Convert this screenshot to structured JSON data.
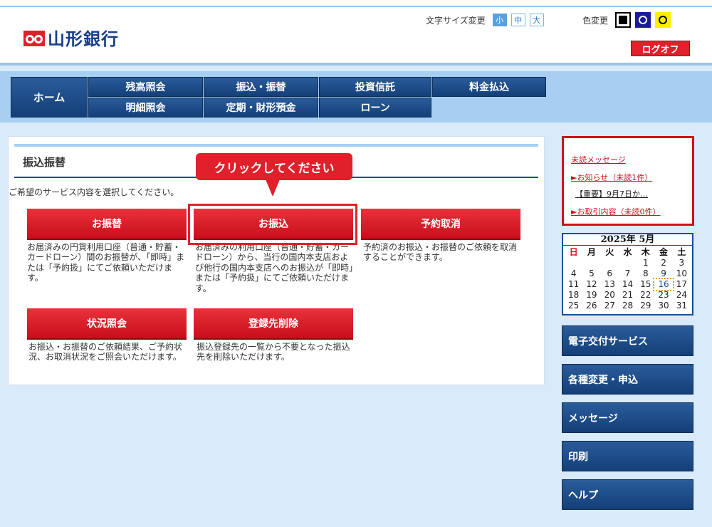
{
  "header": {
    "bank_name": "山形銀行",
    "font_size_label": "文字サイズ変更",
    "font_sizes": [
      "小",
      "中",
      "大"
    ],
    "color_label": "色変更",
    "logout_label": "ログオフ"
  },
  "nav": {
    "home": "ホーム",
    "row1": [
      "残高照会",
      "振込・振替",
      "投資信託",
      "料金払込"
    ],
    "row2": [
      "明細照会",
      "定期・財形預金",
      "ローン"
    ]
  },
  "main": {
    "title": "振込振替",
    "instruction": "ご希望のサービス内容を選択してください。",
    "callout": "クリックしてください",
    "services": [
      {
        "label": "お振替",
        "desc": "お届済みの円貨利用口座（普通・貯蓄・カードローン）間のお振替が、「即時」または「予約扱」にてご依頼いただけます。"
      },
      {
        "label": "お振込",
        "desc": "お届済みの利用口座（普通・貯蓄・カードローン）から、当行の国内本支店および他行の国内本支店へのお振込が「即時」または「予約扱」にてご依頼いただけます。"
      },
      {
        "label": "予約取消",
        "desc": "予約済のお振込・お振替のご依頼を取消することができます。"
      },
      {
        "label": "状況照会",
        "desc": "お振込・お振替のご依頼結果、ご予約状況、お取消状況をご照会いただけます。"
      },
      {
        "label": "登録先削除",
        "desc": "振込登録先の一覧から不要となった振込先を削除いただけます。"
      }
    ]
  },
  "sidebar": {
    "unread_messages": "未読メッセージ",
    "notice_label": "►お知らせ（未読1件）",
    "notice_item": "【重要】9月7日か…",
    "transaction_label": "►お取引内容（未読0件）",
    "calendar": {
      "title": "2025年 5月",
      "weekdays": [
        "日",
        "月",
        "火",
        "水",
        "木",
        "金",
        "土"
      ],
      "days": [
        "",
        "",
        "",
        "",
        "1",
        "2",
        "3",
        "4",
        "5",
        "6",
        "7",
        "8",
        "9",
        "10",
        "11",
        "12",
        "13",
        "14",
        "15",
        "16",
        "17",
        "18",
        "19",
        "20",
        "21",
        "22",
        "23",
        "24",
        "25",
        "26",
        "27",
        "28",
        "29",
        "30",
        "31"
      ],
      "today": "16"
    },
    "buttons": [
      "電子交付サービス",
      "各種変更・申込",
      "メッセージ",
      "印刷",
      "ヘルプ"
    ]
  },
  "colors": {
    "brand_navy": "#1a4f96",
    "accent_red": "#e0202a",
    "background": "#d9ebfb"
  }
}
